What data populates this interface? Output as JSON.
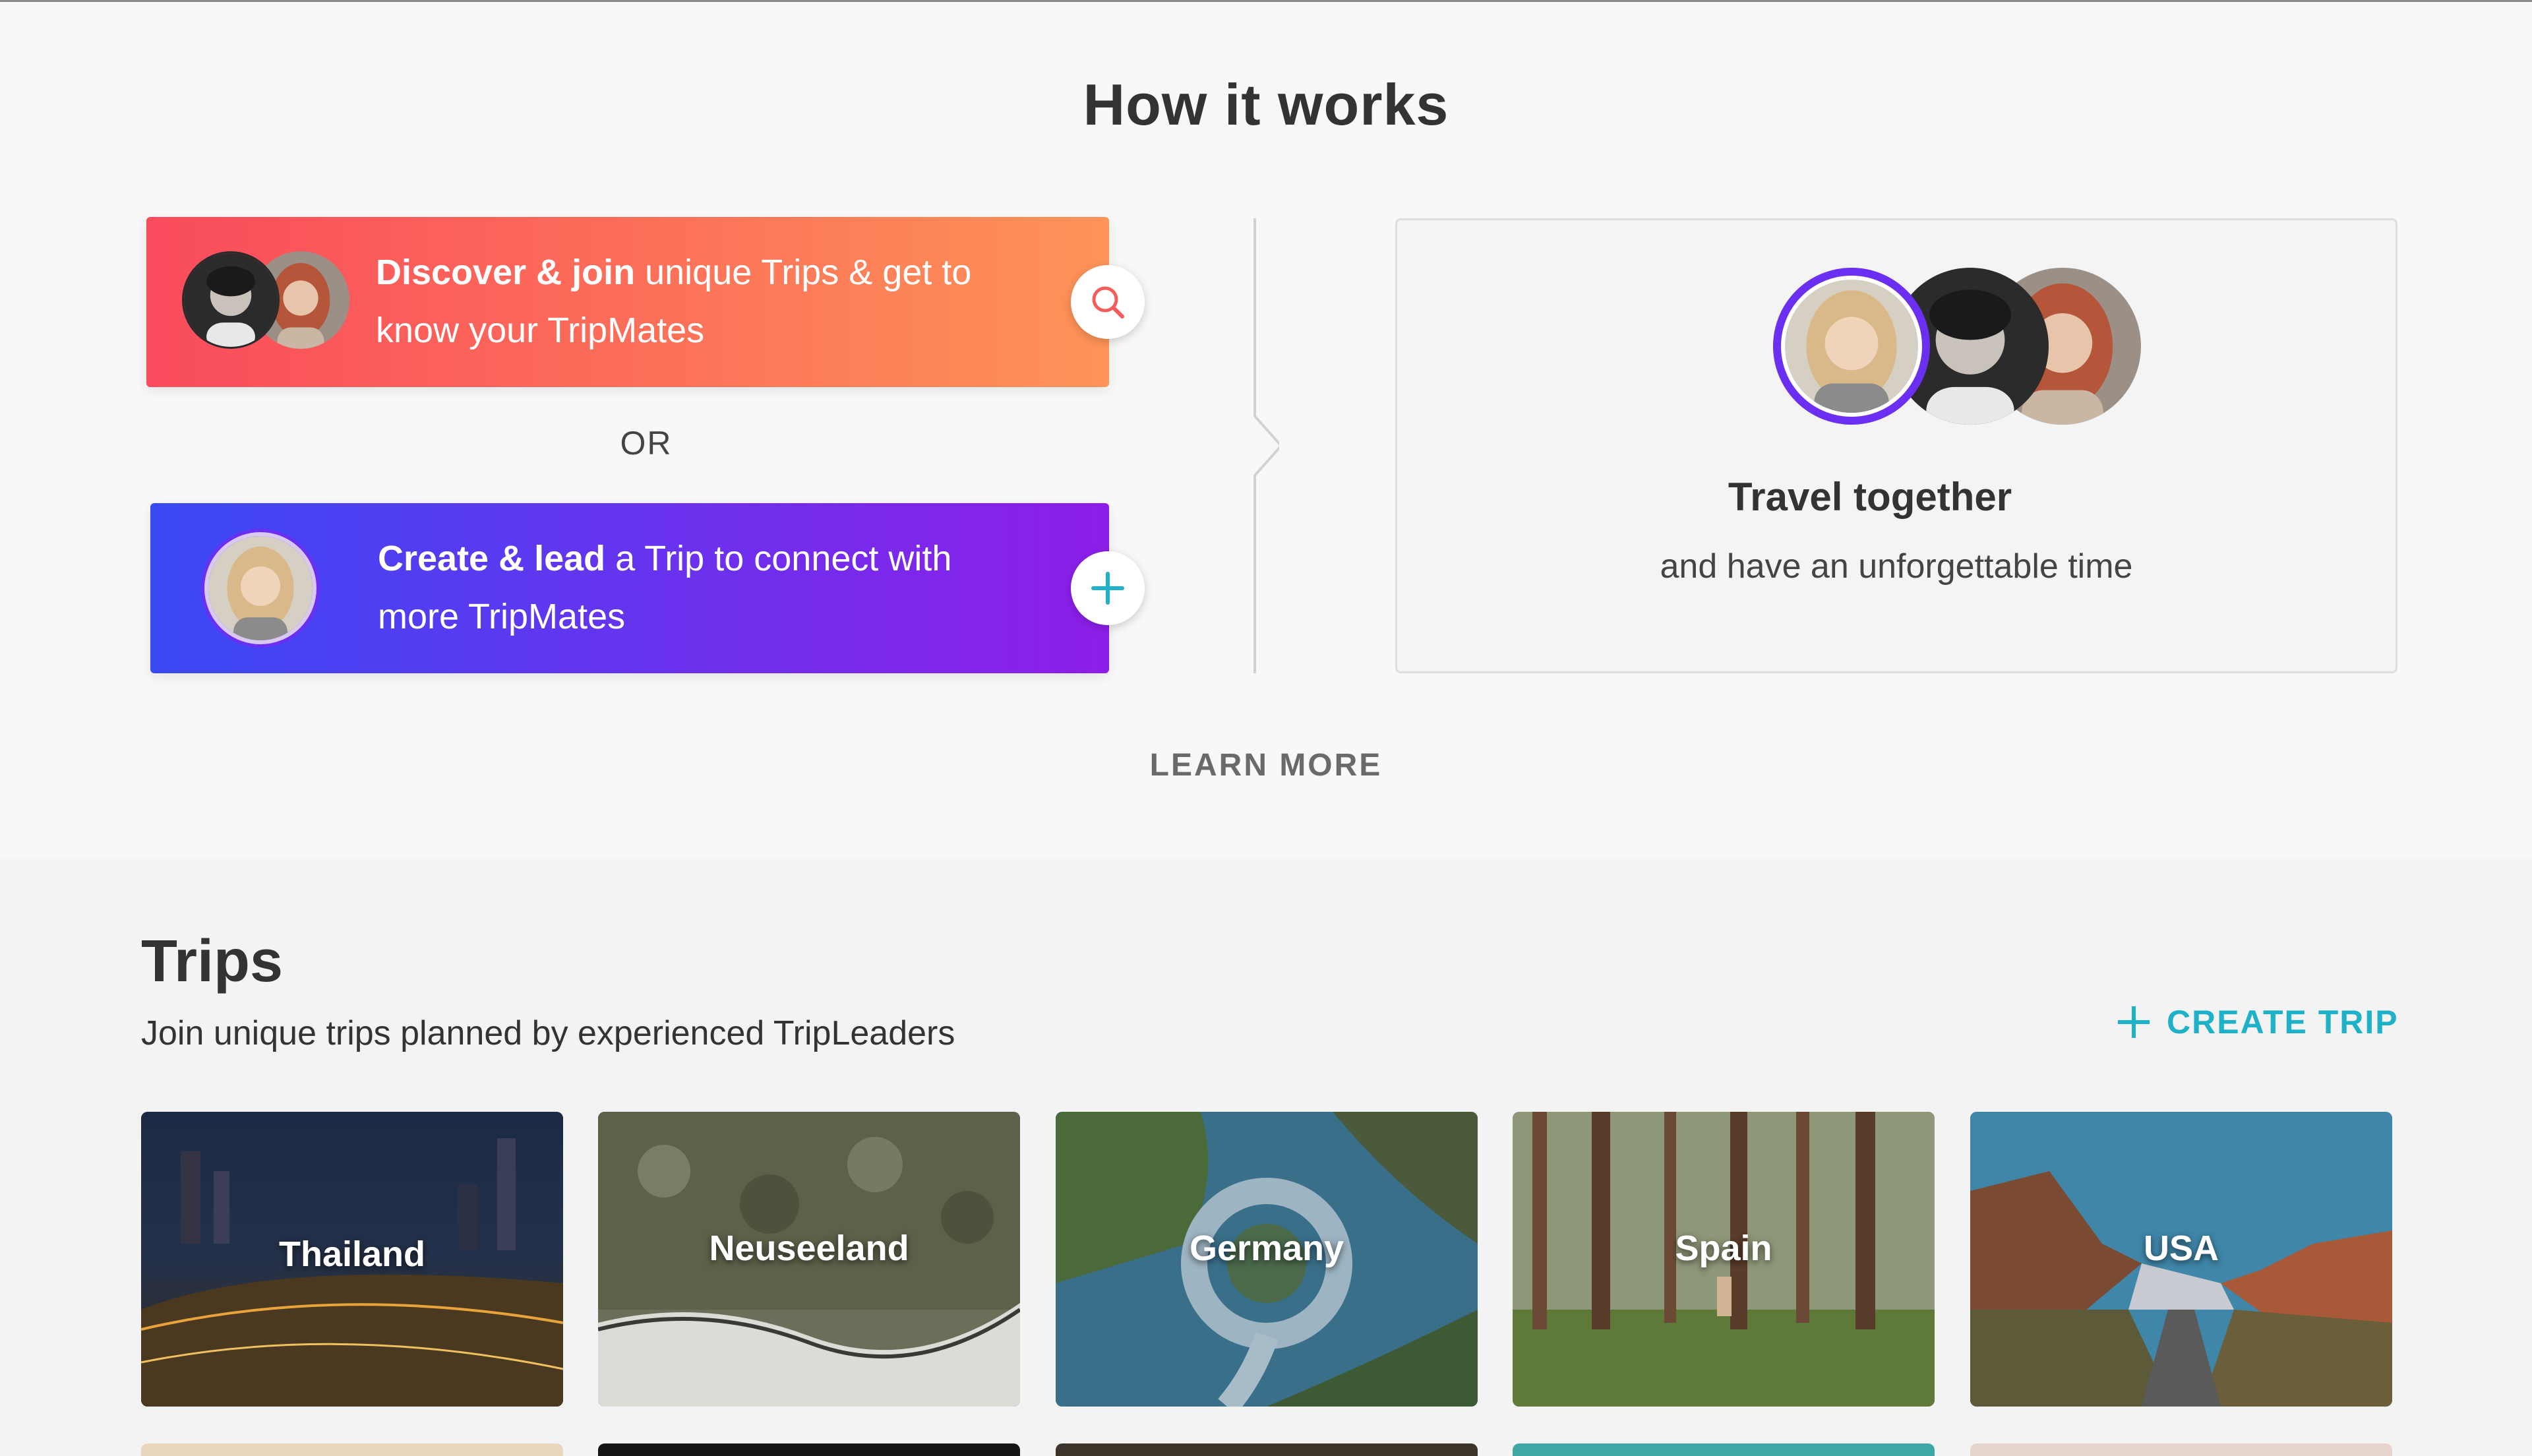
{
  "how_it_works": {
    "title": "How it works",
    "discover": {
      "bold": "Discover & join",
      "line1_rest": " unique Trips & get to",
      "line2": "know your TripMates"
    },
    "or": "OR",
    "create": {
      "bold": "Create & lead",
      "line1_rest": " a Trip to connect with",
      "line2": "more TripMates"
    },
    "travel_title": "Travel together",
    "travel_sub": "and have an unforgettable time",
    "learn_more": "LEARN MORE"
  },
  "trips": {
    "title": "Trips",
    "subtitle": "Join unique trips planned by experienced TripLeaders",
    "create_trip": "CREATE TRIP",
    "cards": [
      "Thailand",
      "Neuseeland",
      "Germany",
      "Spain",
      "USA"
    ]
  },
  "colors": {
    "discover_gradient": [
      "#f94b5c",
      "#fd9458"
    ],
    "create_gradient": [
      "#3a49f4",
      "#8d1ee8"
    ],
    "accent_teal": "#1fb1c8",
    "ring_purple": "#6a2ff0"
  },
  "icons": {
    "discover_button": "search-icon",
    "create_button": "plus-icon",
    "create_trip": "plus-icon"
  }
}
